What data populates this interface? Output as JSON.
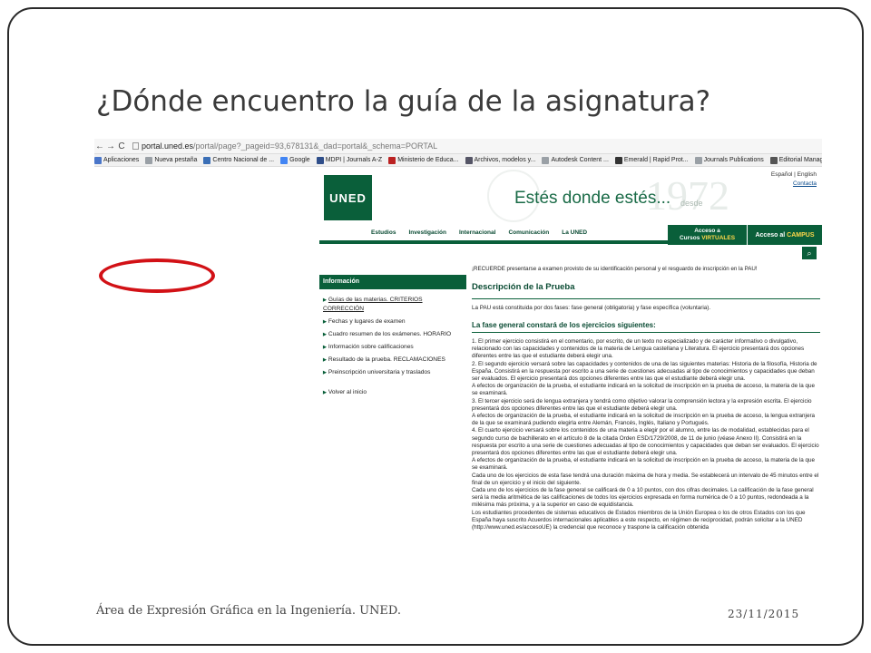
{
  "slide": {
    "title": "¿Dónde encuentro la guía de la asignatura?",
    "footer_left": "Área de Expresión Gráfica en la Ingeniería. UNED.",
    "footer_right": "23/11/2015"
  },
  "browser": {
    "url_host": "portal.uned.es",
    "url_path": "/portal/page?_pageid=93,678131&_dad=portal&_schema=PORTAL",
    "bookmarks": [
      {
        "label": "Aplicaciones",
        "icon": "apps-grid-icon",
        "color": "#4a76c9"
      },
      {
        "label": "Nueva pestaña",
        "icon": "page-icon",
        "color": "#9aa0a6"
      },
      {
        "label": "Centro Nacional de ...",
        "icon": "globe-icon",
        "color": "#3b6fb6"
      },
      {
        "label": "Google",
        "icon": "google-icon",
        "color": "#4285f4"
      },
      {
        "label": "MDPI | Journals A-Z",
        "icon": "mdpi-icon",
        "color": "#2f4e8a"
      },
      {
        "label": "Ministerio de Educa...",
        "icon": "ministry-icon",
        "color": "#b22"
      },
      {
        "label": "Archivos, modelos y...",
        "icon": "star-icon",
        "color": "#556"
      },
      {
        "label": "Autodesk Content ...",
        "icon": "page-icon",
        "color": "#9aa0a6"
      },
      {
        "label": "Emerald | Rapid Prot...",
        "icon": "emerald-icon",
        "color": "#333"
      },
      {
        "label": "Journals Publications",
        "icon": "page-icon",
        "color": "#9aa0a6"
      },
      {
        "label": "Editorial Manager®",
        "icon": "em-icon",
        "color": "#555"
      }
    ]
  },
  "site": {
    "lang": "Español | English",
    "contact": "Contacta",
    "logo": "UNED",
    "slogan": "Estés donde estés...",
    "slogan_year": "1972",
    "slogan_desde": "desde",
    "nav": [
      "Estudios",
      "Investigación",
      "Internacional",
      "Comunicación",
      "La UNED"
    ],
    "virtual_line1": "Acceso a",
    "virtual_line2": "Cursos",
    "virtual_line3": "VIRTUALES",
    "campus_prefix": "Acceso al",
    "campus_word": "CAMPUS",
    "sidebar": {
      "header": "Información",
      "items": [
        "Guías de las materias. CRITERIOS",
        "CORRECCIÓN",
        "Fechas y lugares de examen",
        "Cuadro resumen de los exámenes. HORARIO",
        "Información sobre calificaciones",
        "Resultado de la prueba. RECLAMACIONES",
        "Preinscripción universitaria y traslados",
        "Volver al inicio"
      ]
    },
    "main": {
      "notice": "¡RECUERDE presentarse a examen provisto de su identificación personal y el resguardo de inscripción en la PAU!",
      "heading": "Descripción de la Prueba",
      "intro": "La PAU está constituida por dos fases: fase general (obligatoria) y fase específica (voluntaria).",
      "subheading": "La fase general constará de los ejercicios siguientes:",
      "paragraphs": [
        "1. El primer ejercicio consistirá en el comentario, por escrito, de un texto no especializado y de carácter informativo o divulgativo, relacionado con las capacidades y contenidos de la materia de Lengua castellana y Literatura. El ejercicio presentará dos opciones diferentes entre las que el estudiante deberá elegir una.",
        "2. El segundo ejercicio versará sobre las capacidades y contenidos de una de las siguientes materias: Historia de la filosofía, Historia de España. Consistirá en la respuesta por escrito a una serie de cuestiones adecuadas al tipo de conocimientos y capacidades que deban ser evaluados. El ejercicio presentará dos opciones diferentes entre las que el estudiante deberá elegir una.",
        "A efectos de organización de la prueba, el estudiante indicará en la solicitud de inscripción en la prueba de acceso, la materia de la que se examinará.",
        "3. El tercer ejercicio será de lengua extranjera y tendrá como objetivo valorar la comprensión lectora y la expresión escrita. El ejercicio presentará dos opciones diferentes entre las que el estudiante deberá elegir una.",
        "A efectos de organización de la prueba, el estudiante indicará en la solicitud de inscripción en la prueba de acceso, la lengua extranjera de la que se examinará pudiendo elegirla entre Alemán, Francés, Inglés, Italiano y Portugués.",
        "4. El cuarto ejercicio versará sobre los contenidos de una materia a elegir por el alumno, entre las de modalidad, establecidas para el segundo curso de bachillerato en el artículo 8 de la citada Orden ESD/1729/2008, de 11 de junio (véase Anexo II). Consistirá en la respuesta por escrito a una serie de cuestiones adecuadas al tipo de conocimientos y capacidades que deban ser evaluados. El ejercicio presentará dos opciones diferentes entre las que el estudiante deberá elegir una.",
        "A efectos de organización de la prueba, el estudiante indicará en la solicitud de inscripción en la prueba de acceso, la materia de la que se examinará.",
        "Cada uno de los ejercicios de esta fase tendrá una duración máxima de hora y media. Se establecerá un intervalo de 45 minutos entre el final de un ejercicio y el inicio del siguiente.",
        "Cada uno de los ejercicios de la fase general se calificará de 0 a 10 puntos, con dos cifras decimales. La calificación de la fase general será la media aritmética de las calificaciones de todos los ejercicios expresada en forma numérica de 0 a 10 puntos, redondeada a la milésima más próxima, y a la superior en caso de equidistancia.",
        "Los estudiantes procedentes de sistemas educativos de Estados miembros de la Unión Europea o los de otros Estados con los que España haya suscrito Acuerdos internacionales aplicables a este respecto, en régimen de reciprocidad, podrán solicitar a la UNED (http://www.uned.es/accesoUE) la credencial que reconoce y traspone la calificación obtenida"
      ]
    }
  }
}
